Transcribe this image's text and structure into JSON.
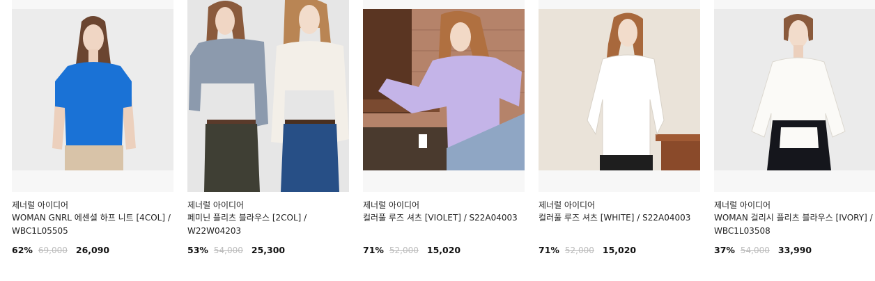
{
  "products": [
    {
      "brand": "제너럴 아이디어",
      "title": "WOMAN GNRL 에센셜 하프 니트 [4COL] / WBC1L05505",
      "discount": "62%",
      "original_price": "69,000",
      "sale_price": "26,090",
      "bg": "#ececec",
      "garment": "#1a72d6"
    },
    {
      "brand": "제너럴 아이디어",
      "title": "페미닌 플리츠 블라우스 [2COL] / W22W04203",
      "discount": "53%",
      "original_price": "54,000",
      "sale_price": "25,300",
      "bg": "#e6e6e6",
      "garment": "#8c9aad"
    },
    {
      "brand": "제너럴 아이디어",
      "title": "컬러풀 루즈 셔츠 [VIOLET] / S22A04003",
      "discount": "71%",
      "original_price": "52,000",
      "sale_price": "15,020",
      "bg": "#b5836a",
      "garment": "#c4b4e8"
    },
    {
      "brand": "제너럴 아이디어",
      "title": "컬러풀 루즈 셔츠 [WHITE] / S22A04003",
      "discount": "71%",
      "original_price": "52,000",
      "sale_price": "15,020",
      "bg": "#eae3d9",
      "garment": "#ffffff"
    },
    {
      "brand": "제너럴 아이디어",
      "title": "WOMAN 걸리시 플리츠 블라우스 [IVORY] / WBC1L03508",
      "discount": "37%",
      "original_price": "54,000",
      "sale_price": "33,990",
      "bg": "#ebebeb",
      "garment": "#fbfaf7"
    }
  ]
}
